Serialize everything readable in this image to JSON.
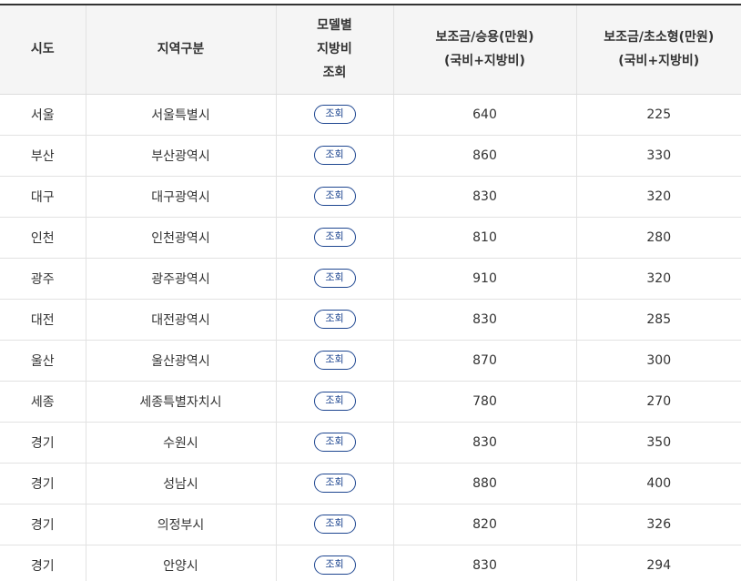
{
  "table": {
    "headers": {
      "sido": "시도",
      "region": "지역구분",
      "model_lookup": [
        "모델별",
        "지방비",
        "조회"
      ],
      "subsidy_passenger": [
        "보조금/승용(만원)",
        "(국비+지방비)"
      ],
      "subsidy_micro": [
        "보조금/초소형(만원)",
        "(국비+지방비)"
      ]
    },
    "lookup_button_label": "조회",
    "rows": [
      {
        "sido": "서울",
        "region": "서울특별시",
        "button": "조회",
        "passenger": "640",
        "micro": "225"
      },
      {
        "sido": "부산",
        "region": "부산광역시",
        "button": "조회",
        "passenger": "860",
        "micro": "330"
      },
      {
        "sido": "대구",
        "region": "대구광역시",
        "button": "조회",
        "passenger": "830",
        "micro": "320"
      },
      {
        "sido": "인천",
        "region": "인천광역시",
        "button": "조회",
        "passenger": "810",
        "micro": "280"
      },
      {
        "sido": "광주",
        "region": "광주광역시",
        "button": "조회",
        "passenger": "910",
        "micro": "320"
      },
      {
        "sido": "대전",
        "region": "대전광역시",
        "button": "조회",
        "passenger": "830",
        "micro": "285"
      },
      {
        "sido": "울산",
        "region": "울산광역시",
        "button": "조회",
        "passenger": "870",
        "micro": "300"
      },
      {
        "sido": "세종",
        "region": "세종특별자치시",
        "button": "조회",
        "passenger": "780",
        "micro": "270"
      },
      {
        "sido": "경기",
        "region": "수원시",
        "button": "조회",
        "passenger": "830",
        "micro": "350"
      },
      {
        "sido": "경기",
        "region": "성남시",
        "button": "조회",
        "passenger": "880",
        "micro": "400"
      },
      {
        "sido": "경기",
        "region": "의정부시",
        "button": "조회",
        "passenger": "820",
        "micro": "326"
      },
      {
        "sido": "경기",
        "region": "안양시",
        "button": "조회",
        "passenger": "830",
        "micro": "294"
      }
    ]
  },
  "colors": {
    "header_bg": "#f5f5f5",
    "header_top_border": "#333333",
    "button_accent": "#1e4690",
    "grid_line": "#e2e2e2"
  }
}
